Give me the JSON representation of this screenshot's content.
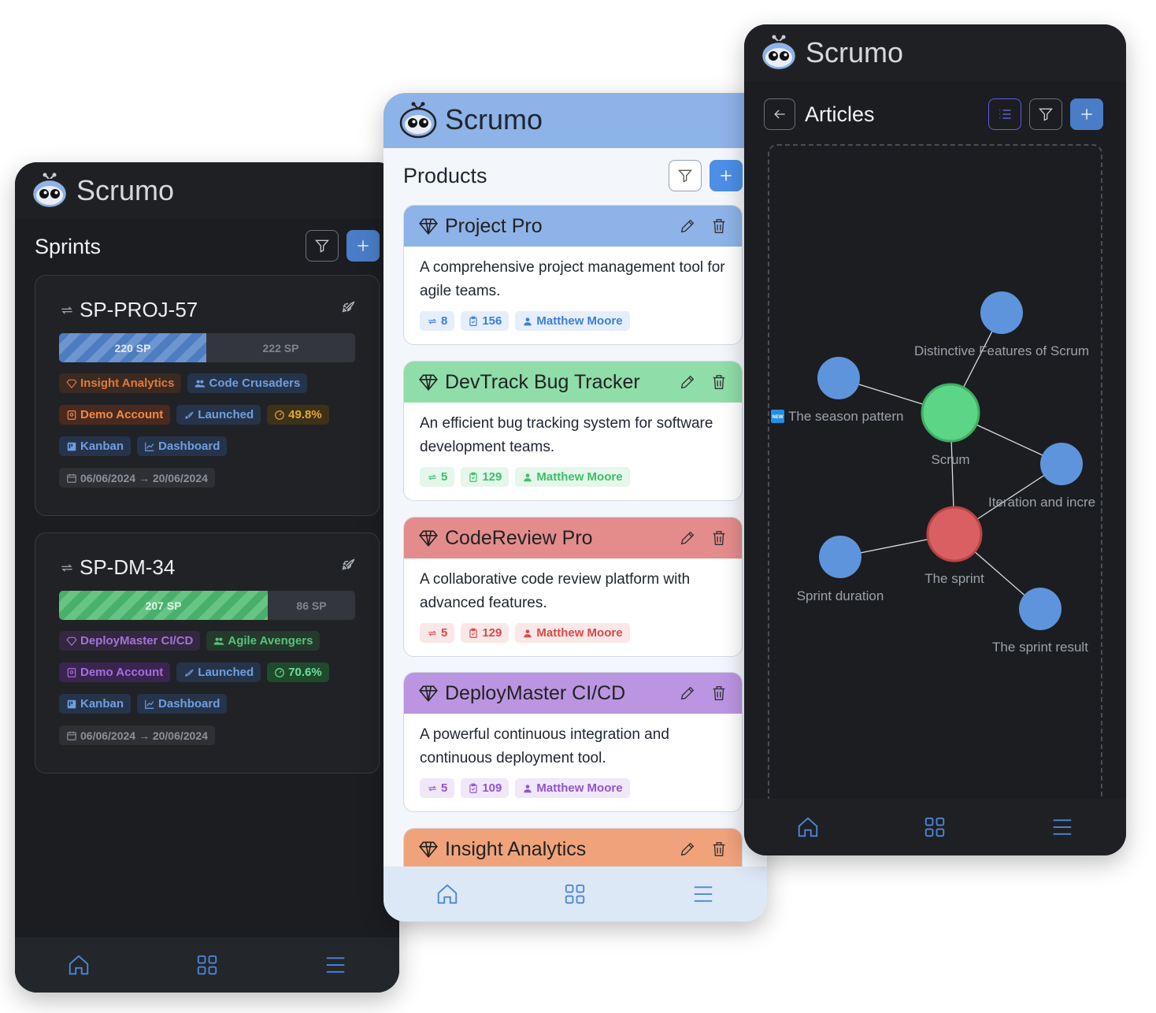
{
  "brand": "Scrumo",
  "sprints_screen": {
    "title": "Sprints",
    "cards": [
      {
        "id": "SP-PROJ-57",
        "done_sp": "220 SP",
        "remaining_sp": "222 SP",
        "progress_fraction": 0.498,
        "product": "Insight Analytics",
        "team": "Code Crusaders",
        "account": "Demo Account",
        "status": "Launched",
        "percent": "49.8%",
        "kanban": "Kanban",
        "dashboard": "Dashboard",
        "dates": "06/06/2024 → 20/06/2024"
      },
      {
        "id": "SP-DM-34",
        "done_sp": "207 SP",
        "remaining_sp": "86 SP",
        "progress_fraction": 0.706,
        "product": "DeployMaster CI/CD",
        "team": "Agile Avengers",
        "account": "Demo Account",
        "status": "Launched",
        "percent": "70.6%",
        "kanban": "Kanban",
        "dashboard": "Dashboard",
        "dates": "06/06/2024 → 20/06/2024"
      }
    ]
  },
  "products_screen": {
    "title": "Products",
    "products": [
      {
        "name": "Project Pro",
        "desc": "A comprehensive project management tool for agile teams.",
        "sprints": "8",
        "items": "156",
        "owner": "Matthew Moore",
        "color": "#8db3e8",
        "accent": "#3d7fd6"
      },
      {
        "name": "DevTrack Bug Tracker",
        "desc": "An efficient bug tracking system for software development teams.",
        "sprints": "5",
        "items": "129",
        "owner": "Matthew Moore",
        "color": "#8fdda8",
        "accent": "#3bbf67"
      },
      {
        "name": "CodeReview Pro",
        "desc": "A collaborative code review platform with advanced features.",
        "sprints": "5",
        "items": "129",
        "owner": "Matthew Moore",
        "color": "#e48c8c",
        "accent": "#d84a4a"
      },
      {
        "name": "DeployMaster CI/CD",
        "desc": "A powerful continuous integration and continuous deployment tool.",
        "sprints": "5",
        "items": "109",
        "owner": "Matthew Moore",
        "color": "#bb95e2",
        "accent": "#9155d0"
      },
      {
        "name": "Insight Analytics",
        "desc": "",
        "sprints": "",
        "items": "",
        "owner": "",
        "color": "#f0a37b",
        "accent": "#e07a3c"
      }
    ]
  },
  "articles_screen": {
    "title": "Articles",
    "graph": {
      "nodes": [
        {
          "label": "Scrum",
          "color": "#5dd586"
        },
        {
          "label": "Distinctive Features of Scrum",
          "color": "#5e94dc"
        },
        {
          "label": "The season pattern",
          "color": "#5e94dc",
          "badge": "NEW"
        },
        {
          "label": "Iteration and incre",
          "color": "#5e94dc"
        },
        {
          "label": "The sprint",
          "color": "#d95f62"
        },
        {
          "label": "Sprint duration",
          "color": "#5e94dc"
        },
        {
          "label": "The sprint result",
          "color": "#5e94dc"
        }
      ]
    }
  },
  "icons": {
    "home": "home-icon",
    "apps": "apps-grid-icon",
    "menu": "menu-icon",
    "filter": "filter-icon",
    "add": "plus-icon",
    "back": "arrow-left-icon",
    "list": "list-icon",
    "edit": "pencil-icon",
    "delete": "trash-icon",
    "gem": "diamond-icon",
    "rocket": "rocket-icon"
  }
}
